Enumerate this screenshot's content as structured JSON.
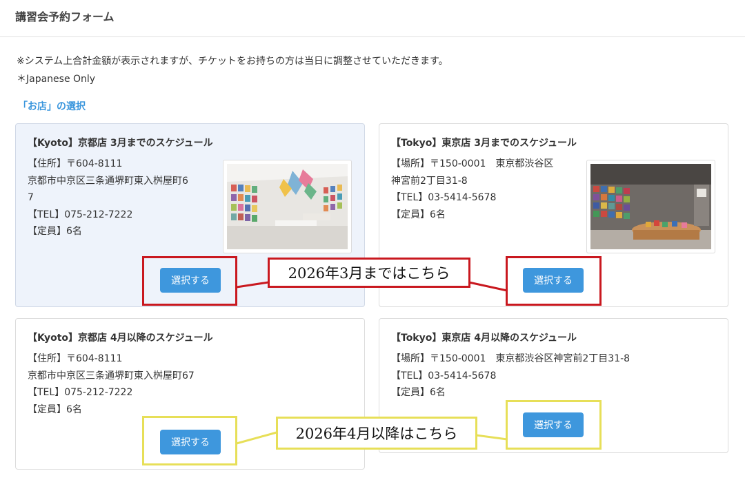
{
  "header": {
    "title": "講習会予約フォーム"
  },
  "notice": "※システム上合計金額が表示されますが、チケットをお持ちの方は当日に調整させていただきます。",
  "note": "＊Japanese Only",
  "section_label": "「お店」の選択",
  "stores": [
    {
      "title": "【Kyoto】京都店 3月までのスケジュール",
      "info": [
        "【住所】〒604-8111",
        "京都市中京区三条通堺町東入桝屋町6",
        "7",
        "【TEL】075-212-7222",
        "【定員】6名"
      ],
      "button": "選択する",
      "selected": true
    },
    {
      "title": "【Tokyo】東京店 3月までのスケジュール",
      "info": [
        "【場所】〒150-0001　東京都渋谷区",
        "神宮前2丁目31-8",
        "【TEL】03-5414-5678",
        "【定員】6名"
      ],
      "button": "選択する",
      "selected": false
    },
    {
      "title": "【Kyoto】京都店 4月以降のスケジュール",
      "info": [
        "【住所】〒604-8111",
        "京都市中京区三条通堺町東入桝屋町67",
        "【TEL】075-212-7222",
        "【定員】6名"
      ],
      "button": "選択する",
      "selected": false
    },
    {
      "title": "【Tokyo】東京店 4月以降のスケジュール",
      "info": [
        "【場所】〒150-0001　東京都渋谷区神宮前2丁目31-8",
        "【TEL】03-5414-5678",
        "【定員】6名"
      ],
      "button": "選択する",
      "selected": false
    }
  ],
  "annotations": {
    "march": {
      "text": "2026年3月まではこちら",
      "color": "#c9181f"
    },
    "april": {
      "text": "2026年4月以降はこちら",
      "color": "#e7df58"
    }
  },
  "colors": {
    "accent": "#3e97dd",
    "section_label": "#3a96dd",
    "selected_card_bg": "#eef3fb"
  }
}
